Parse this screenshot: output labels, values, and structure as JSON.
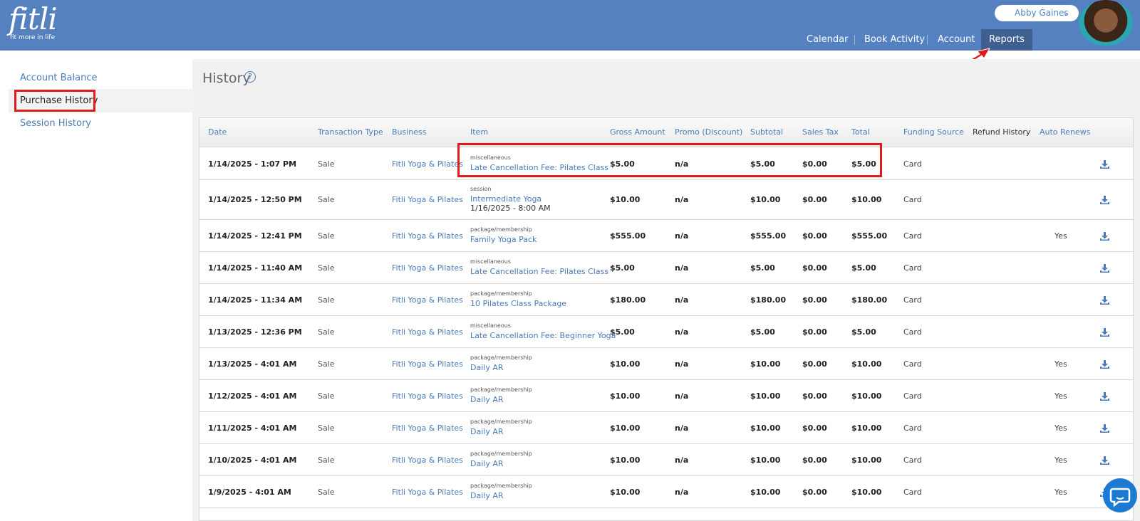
{
  "header": {
    "logo_text": "fitli",
    "logo_tagline": "fit more in life",
    "user_name": "Abby Gaines",
    "nav": [
      {
        "label": "Calendar"
      },
      {
        "label": "Book Activity"
      },
      {
        "label": "Account"
      },
      {
        "label": "Reports"
      }
    ],
    "active_nav": "Reports"
  },
  "sidebar": {
    "items": [
      {
        "label": "Account Balance"
      },
      {
        "label": "Purchase History"
      },
      {
        "label": "Session History"
      }
    ],
    "active": "Purchase History"
  },
  "page": {
    "title": "History",
    "help_glyph": "?"
  },
  "table": {
    "headers": {
      "date": "Date",
      "transaction_type": "Transaction Type",
      "business": "Business",
      "item": "Item",
      "gross": "Gross Amount",
      "promo": "Promo (Discount)",
      "subtotal": "Subtotal",
      "tax": "Sales Tax",
      "total": "Total",
      "funding": "Funding Source",
      "refund": "Refund History",
      "auto": "Auto Renews"
    },
    "rows": [
      {
        "date": "1/14/2025 - 1:07 PM",
        "type": "Sale",
        "business": "Fitli Yoga & Pilates",
        "category": "miscellaneous",
        "item": "Late Cancellation Fee: Pilates Class",
        "extra": "",
        "gross": "$5.00",
        "promo": "n/a",
        "subtotal": "$5.00",
        "tax": "$0.00",
        "total": "$5.00",
        "funding": "Card",
        "auto": ""
      },
      {
        "date": "1/14/2025 - 12:50 PM",
        "type": "Sale",
        "business": "Fitli Yoga & Pilates",
        "category": "session",
        "item": "Intermediate Yoga",
        "extra": "1/16/2025 - 8:00 AM",
        "gross": "$10.00",
        "promo": "n/a",
        "subtotal": "$10.00",
        "tax": "$0.00",
        "total": "$10.00",
        "funding": "Card",
        "auto": ""
      },
      {
        "date": "1/14/2025 - 12:41 PM",
        "type": "Sale",
        "business": "Fitli Yoga & Pilates",
        "category": "package/membership",
        "item": "Family Yoga Pack",
        "extra": "",
        "gross": "$555.00",
        "promo": "n/a",
        "subtotal": "$555.00",
        "tax": "$0.00",
        "total": "$555.00",
        "funding": "Card",
        "auto": "Yes"
      },
      {
        "date": "1/14/2025 - 11:40 AM",
        "type": "Sale",
        "business": "Fitli Yoga & Pilates",
        "category": "miscellaneous",
        "item": "Late Cancellation Fee: Pilates Class",
        "extra": "",
        "gross": "$5.00",
        "promo": "n/a",
        "subtotal": "$5.00",
        "tax": "$0.00",
        "total": "$5.00",
        "funding": "Card",
        "auto": ""
      },
      {
        "date": "1/14/2025 - 11:34 AM",
        "type": "Sale",
        "business": "Fitli Yoga & Pilates",
        "category": "package/membership",
        "item": "10 Pilates Class Package",
        "extra": "",
        "gross": "$180.00",
        "promo": "n/a",
        "subtotal": "$180.00",
        "tax": "$0.00",
        "total": "$180.00",
        "funding": "Card",
        "auto": ""
      },
      {
        "date": "1/13/2025 - 12:36 PM",
        "type": "Sale",
        "business": "Fitli Yoga & Pilates",
        "category": "miscellaneous",
        "item": "Late Cancellation Fee: Beginner Yoga",
        "extra": "",
        "gross": "$5.00",
        "promo": "n/a",
        "subtotal": "$5.00",
        "tax": "$0.00",
        "total": "$5.00",
        "funding": "Card",
        "auto": ""
      },
      {
        "date": "1/13/2025 - 4:01 AM",
        "type": "Sale",
        "business": "Fitli Yoga & Pilates",
        "category": "package/membership",
        "item": "Daily AR",
        "extra": "",
        "gross": "$10.00",
        "promo": "n/a",
        "subtotal": "$10.00",
        "tax": "$0.00",
        "total": "$10.00",
        "funding": "Card",
        "auto": "Yes"
      },
      {
        "date": "1/12/2025 - 4:01 AM",
        "type": "Sale",
        "business": "Fitli Yoga & Pilates",
        "category": "package/membership",
        "item": "Daily AR",
        "extra": "",
        "gross": "$10.00",
        "promo": "n/a",
        "subtotal": "$10.00",
        "tax": "$0.00",
        "total": "$10.00",
        "funding": "Card",
        "auto": "Yes"
      },
      {
        "date": "1/11/2025 - 4:01 AM",
        "type": "Sale",
        "business": "Fitli Yoga & Pilates",
        "category": "package/membership",
        "item": "Daily AR",
        "extra": "",
        "gross": "$10.00",
        "promo": "n/a",
        "subtotal": "$10.00",
        "tax": "$0.00",
        "total": "$10.00",
        "funding": "Card",
        "auto": "Yes"
      },
      {
        "date": "1/10/2025 - 4:01 AM",
        "type": "Sale",
        "business": "Fitli Yoga & Pilates",
        "category": "package/membership",
        "item": "Daily AR",
        "extra": "",
        "gross": "$10.00",
        "promo": "n/a",
        "subtotal": "$10.00",
        "tax": "$0.00",
        "total": "$10.00",
        "funding": "Card",
        "auto": "Yes"
      },
      {
        "date": "1/9/2025 - 4:01 AM",
        "type": "Sale",
        "business": "Fitli Yoga & Pilates",
        "category": "package/membership",
        "item": "Daily AR",
        "extra": "",
        "gross": "$10.00",
        "promo": "n/a",
        "subtotal": "$10.00",
        "tax": "$0.00",
        "total": "$10.00",
        "funding": "Card",
        "auto": "Yes"
      }
    ]
  },
  "colors": {
    "header_bg": "#5581c1",
    "link": "#4a7bb7",
    "highlight_red": "#e01b1b"
  }
}
